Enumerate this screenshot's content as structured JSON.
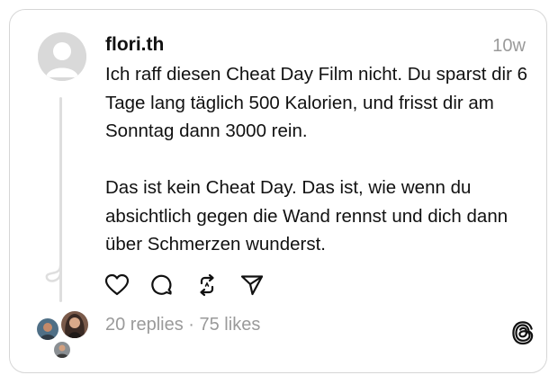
{
  "post": {
    "username": "flori.th",
    "time": "10w",
    "paragraphs": [
      "Ich raff diesen Cheat Day Film nicht. Du sparst dir 6 Tage lang täglich 500 Kalorien, und frisst dir am Sonntag dann 3000 rein.",
      "Das ist kein Cheat Day. Das ist, wie wenn du absichtlich gegen die Wand rennst und dich dann über Schmerzen wunderst."
    ]
  },
  "actions": [
    {
      "icon": "heart-icon"
    },
    {
      "icon": "comment-icon"
    },
    {
      "icon": "repost-icon"
    },
    {
      "icon": "share-icon"
    }
  ],
  "stats": {
    "replies": "20 replies",
    "separator": " · ",
    "likes": "75 likes"
  },
  "colors": {
    "text": "#111111",
    "muted": "#9a9a9a",
    "border": "#d6d6d6"
  }
}
